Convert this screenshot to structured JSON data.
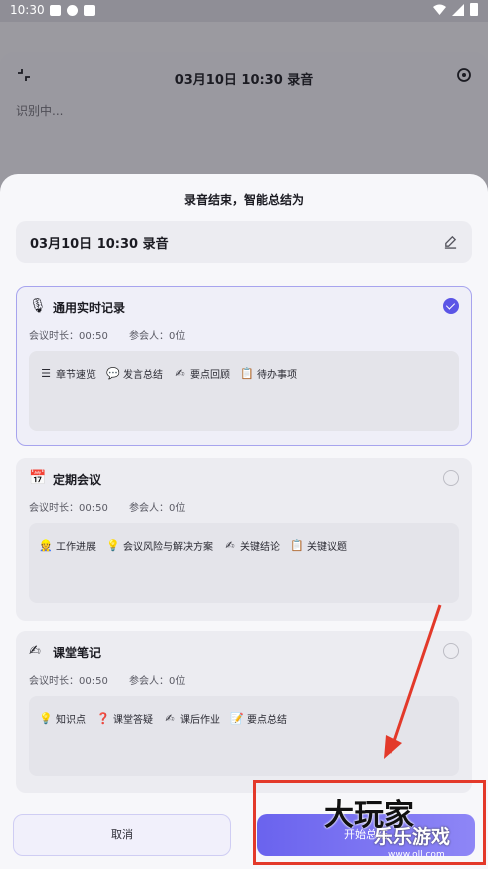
{
  "status_bar": {
    "time": "10:30"
  },
  "background_page": {
    "title": "03月10日 10:30 录音",
    "status": "识别中..."
  },
  "sheet": {
    "title": "录音结束，智能总结为",
    "recording_name": "03月10日 10:30 录音",
    "cards": [
      {
        "icon": "microphone-icon",
        "emoji": "🎙",
        "title": "通用实时记录",
        "duration": "会议时长：00:50",
        "participants": "参会人：0位",
        "selected": true,
        "tags": [
          {
            "icon": "list-icon",
            "glyph": "☰",
            "label": "章节速览"
          },
          {
            "icon": "chat-icon",
            "glyph": "💬",
            "label": "发言总结"
          },
          {
            "icon": "pen-icon",
            "glyph": "✍",
            "label": "要点回顾"
          },
          {
            "icon": "checklist-icon",
            "glyph": "📋",
            "label": "待办事项"
          }
        ]
      },
      {
        "icon": "calendar-icon",
        "emoji": "📅",
        "title": "定期会议",
        "duration": "会议时长：00:50",
        "participants": "参会人：0位",
        "selected": false,
        "tags": [
          {
            "icon": "worker-icon",
            "glyph": "👷",
            "label": "工作进展"
          },
          {
            "icon": "bulb-icon",
            "glyph": "💡",
            "label": "会议风险与解决方案"
          },
          {
            "icon": "pen-icon",
            "glyph": "✍",
            "label": "关键结论"
          },
          {
            "icon": "checklist-icon",
            "glyph": "📋",
            "label": "关键议题"
          }
        ]
      },
      {
        "icon": "pen-icon",
        "emoji": "✍",
        "title": "课堂笔记",
        "duration": "会议时长：00:50",
        "participants": "参会人：0位",
        "selected": false,
        "tags": [
          {
            "icon": "bulb-icon",
            "glyph": "💡",
            "label": "知识点"
          },
          {
            "icon": "qa-icon",
            "glyph": "❓",
            "label": "课堂答疑"
          },
          {
            "icon": "pen-icon",
            "glyph": "✍",
            "label": "课后作业"
          },
          {
            "icon": "edit-icon",
            "glyph": "📝",
            "label": "要点总结"
          }
        ]
      }
    ],
    "cancel_label": "取消",
    "start_label": "开始总结"
  },
  "watermark": {
    "big": "大玩家",
    "small": "乐乐游戏",
    "url": "www.oll.com"
  },
  "colors": {
    "accent": "#5b55e6",
    "annotation": "#e3392a"
  }
}
